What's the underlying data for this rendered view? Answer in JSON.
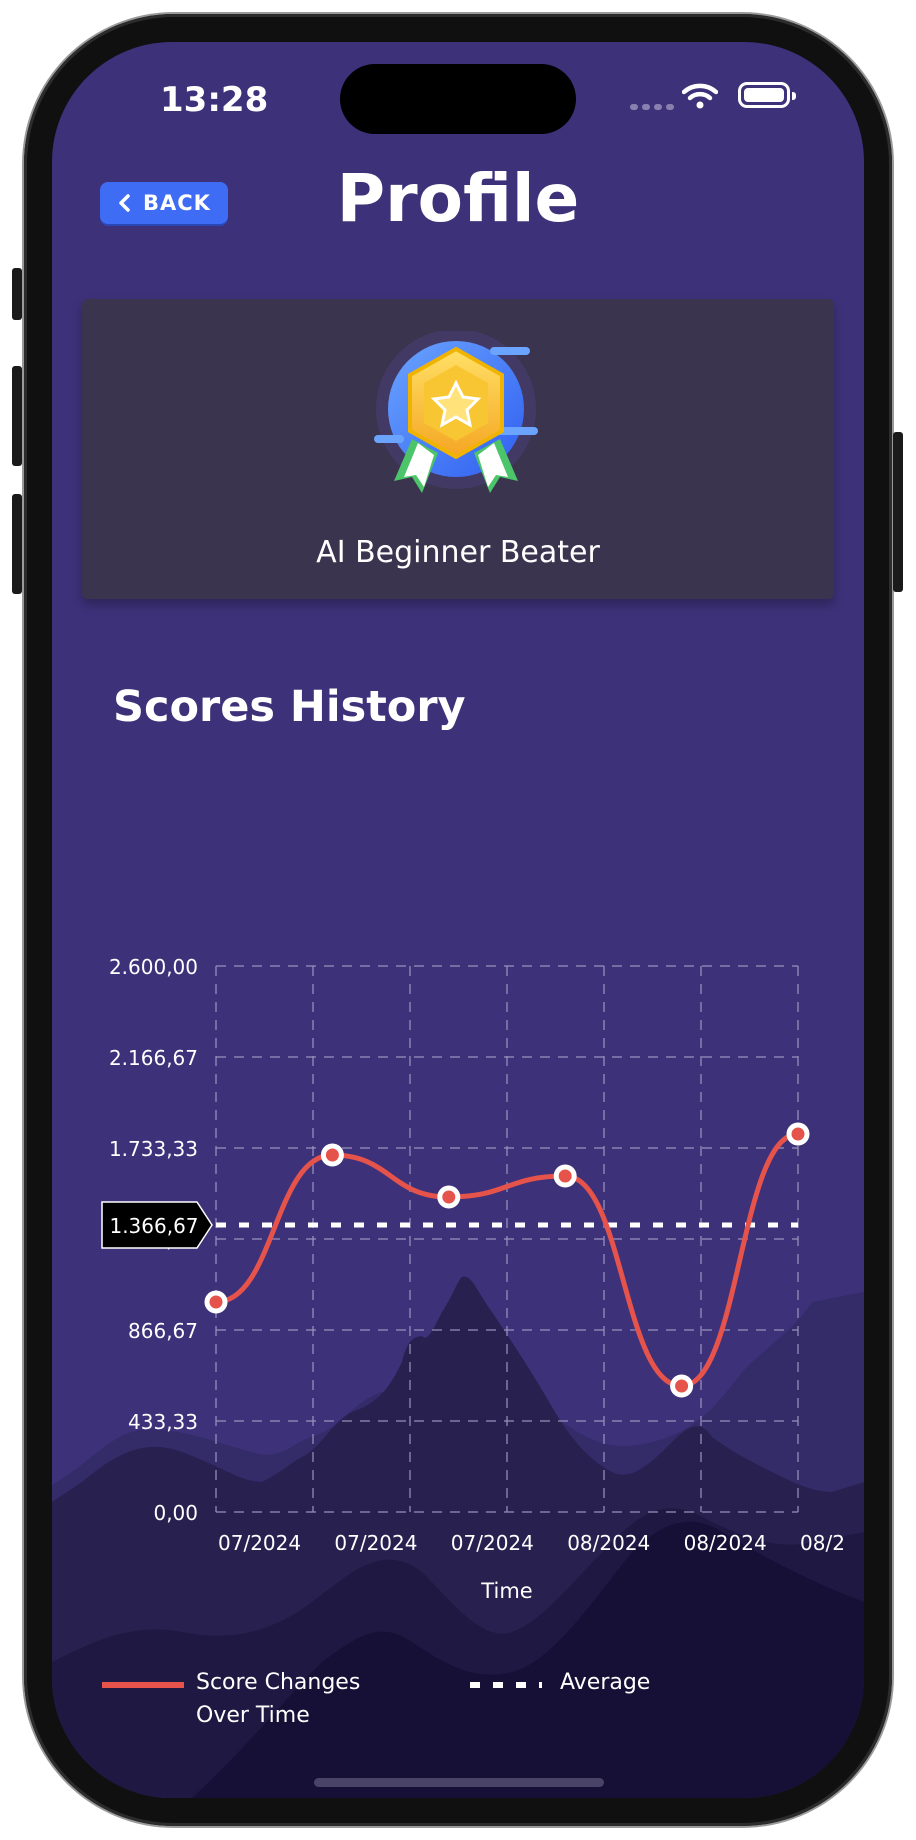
{
  "status_bar": {
    "time": "13:28"
  },
  "header": {
    "back_label": "BACK",
    "title": "Profile"
  },
  "achievement": {
    "title": "AI Beginner Beater",
    "icon": "star-medal-icon"
  },
  "scores_section": {
    "title": "Scores History"
  },
  "colors": {
    "background": "#3d3179",
    "line": "#e5534b",
    "accent": "#3f6cf4",
    "card": "#3a344f"
  },
  "chart_data": {
    "type": "line",
    "xlabel": "Time",
    "ylabel": "",
    "ylim": [
      0,
      2600
    ],
    "y_ticks": [
      "0,00",
      "433,33",
      "866,67",
      "1.300,00",
      "1.733,33",
      "2.166,67",
      "2.600,00"
    ],
    "x_tick_labels": [
      "07/2024",
      "07/2024",
      "07/2024",
      "08/2024",
      "08/2024",
      "08/2"
    ],
    "grid": true,
    "series": [
      {
        "name": "Score Changes Over Time",
        "values": [
          1000,
          1700,
          1500,
          1600,
          600,
          1800
        ]
      }
    ],
    "average": {
      "name": "Average",
      "value": 1366.67,
      "label": "1.366,67"
    },
    "legend": {
      "position": "bottom",
      "items": [
        "Score Changes Over Time",
        "Average"
      ]
    }
  }
}
